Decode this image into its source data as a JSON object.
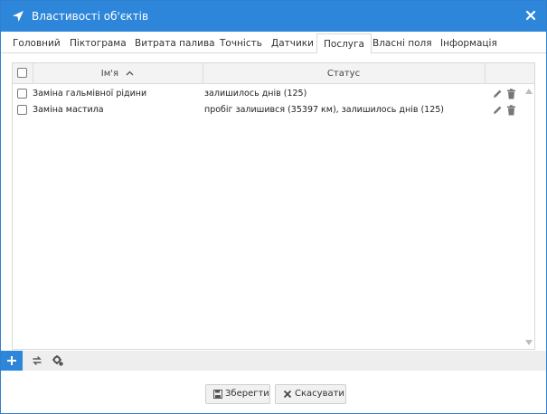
{
  "window": {
    "title": "Властивості об'єктів",
    "accent_color": "#2d86d9",
    "icons": {
      "title": "navigation-arrow-icon",
      "close": "close-icon"
    }
  },
  "tabs": [
    {
      "label": "Головний",
      "active": false
    },
    {
      "label": "Піктограма",
      "active": false
    },
    {
      "label": "Витрата палива",
      "active": false
    },
    {
      "label": "Точність",
      "active": false
    },
    {
      "label": "Датчики",
      "active": false
    },
    {
      "label": "Послуга",
      "active": true
    },
    {
      "label": "Власні поля",
      "active": false
    },
    {
      "label": "Інформація",
      "active": false
    }
  ],
  "table": {
    "columns": {
      "name": "Ім'я",
      "status": "Статус"
    },
    "sort": "ascending",
    "rows": [
      {
        "name": "Заміна гальмівної рідини",
        "status": "залишилось днів (125)"
      },
      {
        "name": "Заміна мастила",
        "status": "пробіг залишився (35397 км), залишилось днів (125)"
      }
    ],
    "row_icons": [
      "edit-pencil-icon",
      "delete-trash-icon"
    ]
  },
  "toolbar": {
    "icons": [
      "add-icon",
      "refresh-icon",
      "settings-icon"
    ]
  },
  "footer": {
    "save_label": "Зберегти",
    "cancel_label": "Скасувати"
  }
}
